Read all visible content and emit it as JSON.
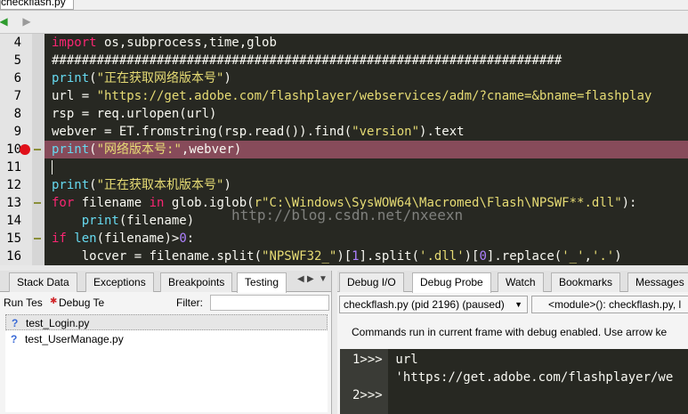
{
  "file_tab": {
    "label": "checkflash.py"
  },
  "nav": {
    "back_icon": "▶",
    "forward_icon": "▶"
  },
  "editor": {
    "lines": [
      {
        "num": "4",
        "segments": [
          {
            "t": "import",
            "c": "kw"
          },
          {
            "t": " os,subprocess,time,glob",
            "c": ""
          }
        ]
      },
      {
        "num": "5",
        "segments": [
          {
            "t": "####################################################################",
            "c": ""
          }
        ]
      },
      {
        "num": "6",
        "segments": [
          {
            "t": "print",
            "c": "fn"
          },
          {
            "t": "(",
            "c": ""
          },
          {
            "t": "\"正在获取网络版本号\"",
            "c": "str"
          },
          {
            "t": ")",
            "c": ""
          }
        ]
      },
      {
        "num": "7",
        "segments": [
          {
            "t": "url = ",
            "c": ""
          },
          {
            "t": "\"https://get.adobe.com/flashplayer/webservices/adm/?cname=&bname=flashplay",
            "c": "str"
          }
        ]
      },
      {
        "num": "8",
        "segments": [
          {
            "t": "rsp = req.urlopen(url)",
            "c": ""
          }
        ]
      },
      {
        "num": "9",
        "segments": [
          {
            "t": "webver = ET.fromstring(rsp.read()).find(",
            "c": ""
          },
          {
            "t": "\"version\"",
            "c": "str"
          },
          {
            "t": ").text",
            "c": ""
          }
        ]
      },
      {
        "num": "10",
        "segments": [
          {
            "t": "print",
            "c": "fn"
          },
          {
            "t": "(",
            "c": ""
          },
          {
            "t": "\"网络版本号:\"",
            "c": "str"
          },
          {
            "t": ",webver)",
            "c": ""
          }
        ]
      },
      {
        "num": "11",
        "segments": []
      },
      {
        "num": "12",
        "segments": [
          {
            "t": "print",
            "c": "fn"
          },
          {
            "t": "(",
            "c": ""
          },
          {
            "t": "\"正在获取本机版本号\"",
            "c": "str"
          },
          {
            "t": ")",
            "c": ""
          }
        ]
      },
      {
        "num": "13",
        "segments": [
          {
            "t": "for",
            "c": "kw"
          },
          {
            "t": " filename ",
            "c": ""
          },
          {
            "t": "in",
            "c": "kw"
          },
          {
            "t": " glob.iglob(",
            "c": ""
          },
          {
            "t": "r\"C:\\Windows\\SysWOW64\\Macromed\\Flash\\NPSWF**.dll\"",
            "c": "str"
          },
          {
            "t": "):",
            "c": ""
          }
        ]
      },
      {
        "num": "14",
        "segments": [
          {
            "t": "    ",
            "c": ""
          },
          {
            "t": "print",
            "c": "fn"
          },
          {
            "t": "(filename)",
            "c": ""
          }
        ]
      },
      {
        "num": "15",
        "segments": [
          {
            "t": "if",
            "c": "kw"
          },
          {
            "t": " ",
            "c": ""
          },
          {
            "t": "len",
            "c": "fn"
          },
          {
            "t": "(filename)>",
            "c": ""
          },
          {
            "t": "0",
            "c": "num"
          },
          {
            "t": ":",
            "c": ""
          }
        ]
      },
      {
        "num": "16",
        "segments": [
          {
            "t": "    locver = filename.split(",
            "c": ""
          },
          {
            "t": "\"NPSWF32_\"",
            "c": "str"
          },
          {
            "t": ")[",
            "c": ""
          },
          {
            "t": "1",
            "c": "num"
          },
          {
            "t": "].split(",
            "c": ""
          },
          {
            "t": "'.dll'",
            "c": "str"
          },
          {
            "t": ")[",
            "c": ""
          },
          {
            "t": "0",
            "c": "num"
          },
          {
            "t": "].replace(",
            "c": ""
          },
          {
            "t": "'_'",
            "c": "str"
          },
          {
            "t": ",",
            "c": ""
          },
          {
            "t": "'.'",
            "c": "str"
          },
          {
            "t": ")",
            "c": ""
          }
        ]
      }
    ],
    "highlight_line": "10",
    "breakpoint_line": "10",
    "fold_lines": [
      "10",
      "13",
      "15"
    ],
    "watermark": "http://blog.csdn.net/nxeexn"
  },
  "left_panel": {
    "tabs": [
      "Stack Data",
      "Exceptions",
      "Breakpoints",
      "Testing"
    ],
    "active_tab": "Testing",
    "run_tests_label": "Run Tes",
    "debug_tests_label": "Debug Te",
    "filter_label": "Filter:",
    "filter_value": "",
    "tests": [
      {
        "icon": "?",
        "name": "test_Login.py",
        "selected": true
      },
      {
        "icon": "?",
        "name": "test_UserManage.py",
        "selected": false
      }
    ]
  },
  "right_panel": {
    "tabs": [
      "Debug I/O",
      "Debug Probe",
      "Watch",
      "Bookmarks",
      "Messages"
    ],
    "active_tab": "Debug Probe",
    "process_select": "checkflash.py (pid 2196) (paused)",
    "frame_select": "<module>(): checkflash.py, l",
    "info": "Commands run in current frame with debug enabled.  Use arrow ke",
    "console": [
      {
        "prompt": "1>>>",
        "text": " url"
      },
      {
        "prompt": "",
        "text": " 'https://get.adobe.com/flashplayer/we"
      },
      {
        "prompt": "2>>>",
        "text": ""
      }
    ]
  },
  "colors": {
    "editor_bg": "#272822",
    "highlight": "#874b5a",
    "keyword": "#f92672",
    "string": "#e6db74",
    "builtin": "#66d9ef",
    "number": "#ae81ff",
    "breakpoint": "#e0101a"
  }
}
